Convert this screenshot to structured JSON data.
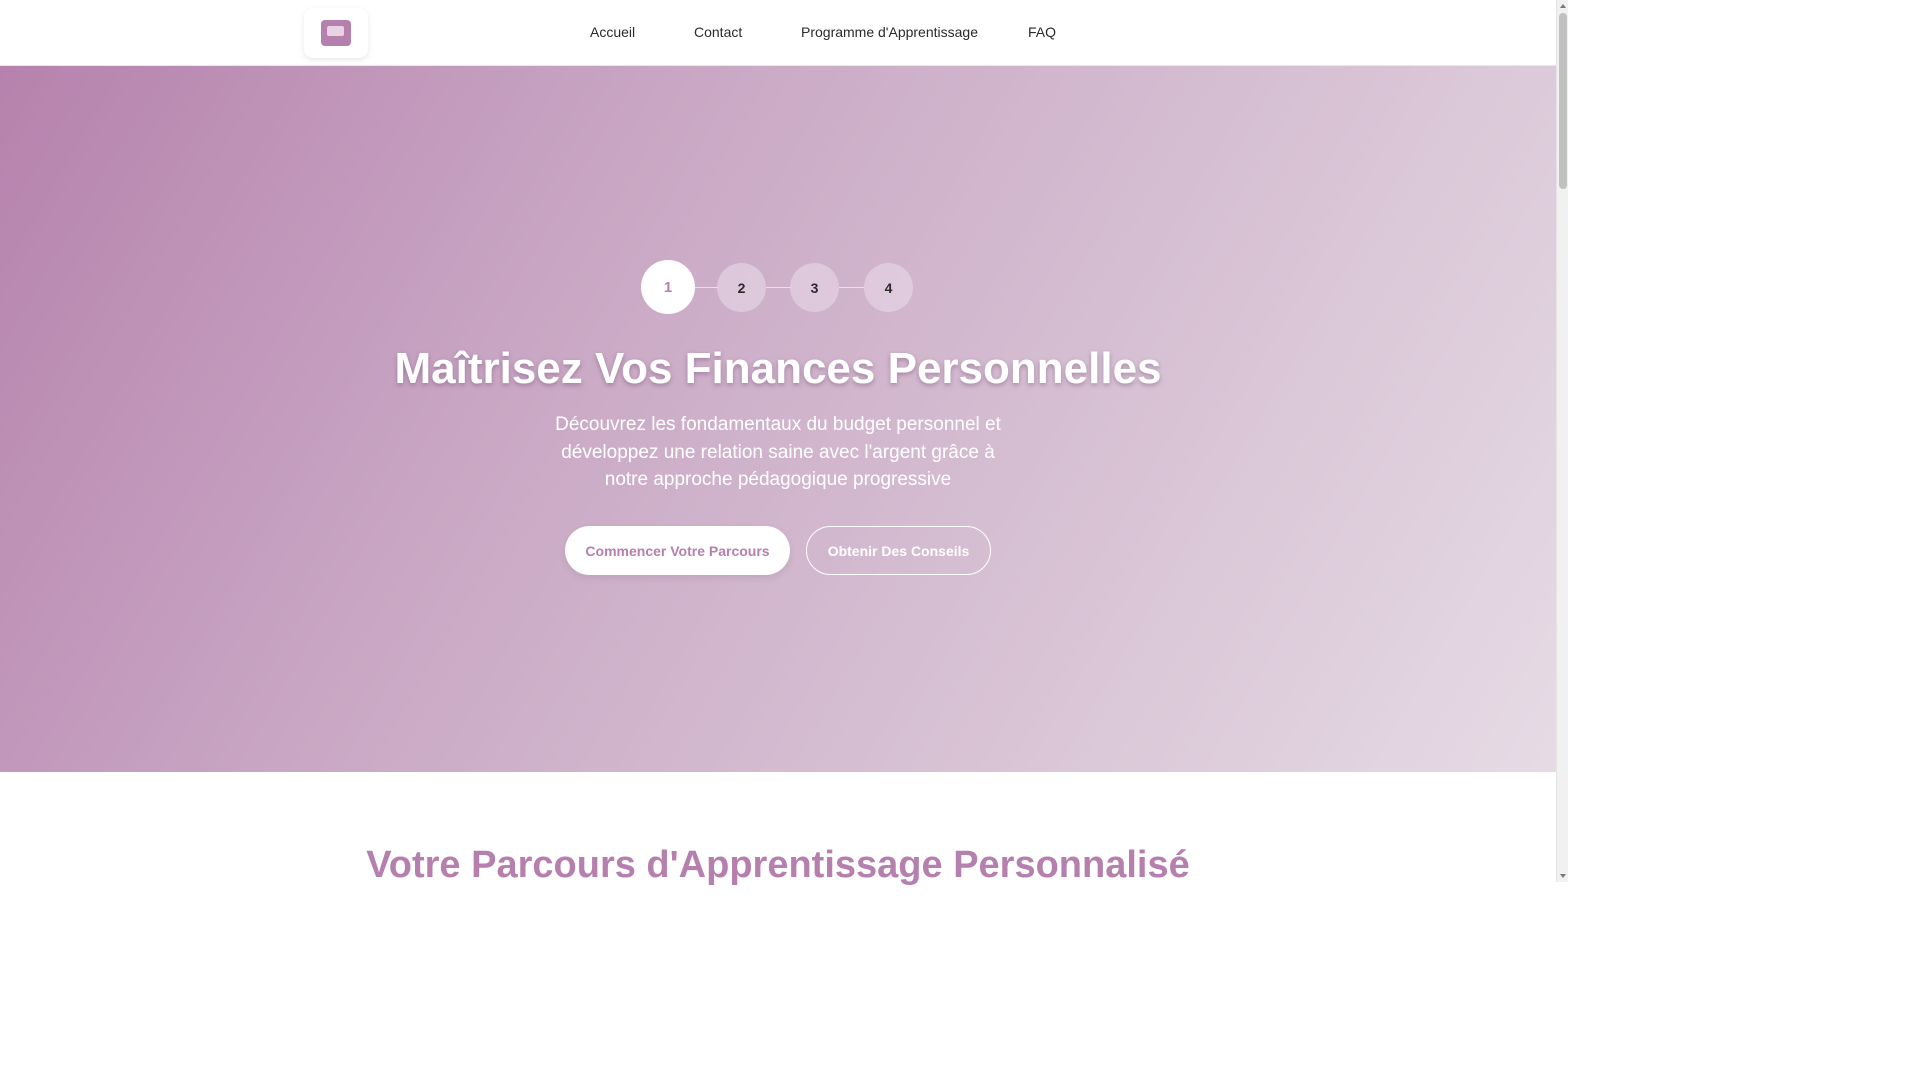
{
  "header": {
    "logo_icon": "wallet-icon",
    "nav": [
      {
        "label": "Accueil"
      },
      {
        "label": "Contact"
      },
      {
        "label": "Programme d'Apprentissage"
      },
      {
        "label": "FAQ"
      }
    ]
  },
  "hero": {
    "steps": [
      {
        "label": "1",
        "active": true
      },
      {
        "label": "2",
        "active": false
      },
      {
        "label": "3",
        "active": false
      },
      {
        "label": "4",
        "active": false
      }
    ],
    "title": "Maîtrisez Vos Finances Personnelles",
    "subtitle": "Découvrez les fondamentaux du budget personnel et développez une relation saine avec l'argent grâce à notre approche pédagogique progressive",
    "primary_button": "Commencer Votre Parcours",
    "secondary_button": "Obtenir Des Conseils"
  },
  "section": {
    "title": "Votre Parcours d'Apprentissage Personnalisé"
  },
  "colors": {
    "accent": "#b57fae",
    "text": "#2a2a2a",
    "hero_gradient_start": "#b682ad",
    "hero_gradient_end": "#e6dbe5"
  }
}
